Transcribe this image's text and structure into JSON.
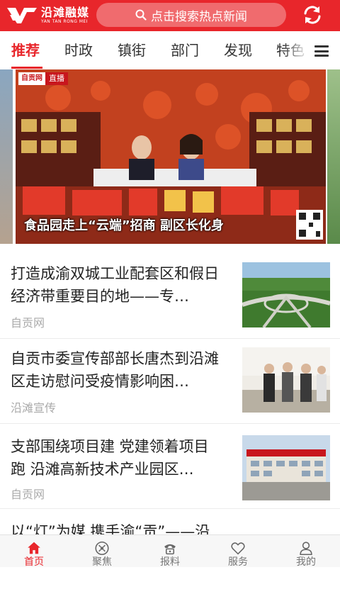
{
  "header": {
    "logo_cn": "沿滩融媒",
    "logo_en": "YAN TAN RONG MEI",
    "search_placeholder": "点击搜索热点新闻"
  },
  "tabs": [
    {
      "label": "推荐",
      "active": true
    },
    {
      "label": "时政"
    },
    {
      "label": "镇街"
    },
    {
      "label": "部门"
    },
    {
      "label": "发现"
    },
    {
      "label": "特色"
    }
  ],
  "banner": {
    "caption": "食品园走上“云端”招商 副区长化身",
    "badge_logo": "自贡网",
    "badge_live": "直播"
  },
  "news": [
    {
      "title": "打造成渝双城工业配套区和假日经济带重要目的地——专…",
      "source": "自贡网",
      "thumb": "highway-interchange"
    },
    {
      "title": "自贡市委宣传部部长唐杰到沿滩区走访慰问受疫情影响困…",
      "source": "沿滩宣传",
      "thumb": "officials-visit"
    },
    {
      "title": "支部围绕项目建 党建领着项目跑 沿滩高新技术产业园区…",
      "source": "自贡网",
      "thumb": "industrial-park-building"
    },
    {
      "title": "以“灯”为媒 携手渝“贡”——沿滩",
      "source": "",
      "thumb": ""
    }
  ],
  "bottom_nav": [
    {
      "label": "首页",
      "icon": "home-icon",
      "active": true
    },
    {
      "label": "聚焦",
      "icon": "focus-icon"
    },
    {
      "label": "报料",
      "icon": "phone-icon"
    },
    {
      "label": "服务",
      "icon": "heart-icon"
    },
    {
      "label": "我的",
      "icon": "user-icon"
    }
  ],
  "colors": {
    "brand_red": "#e8262b",
    "search_bg": "#f06b6e",
    "source_gray": "#aaaaaa"
  }
}
